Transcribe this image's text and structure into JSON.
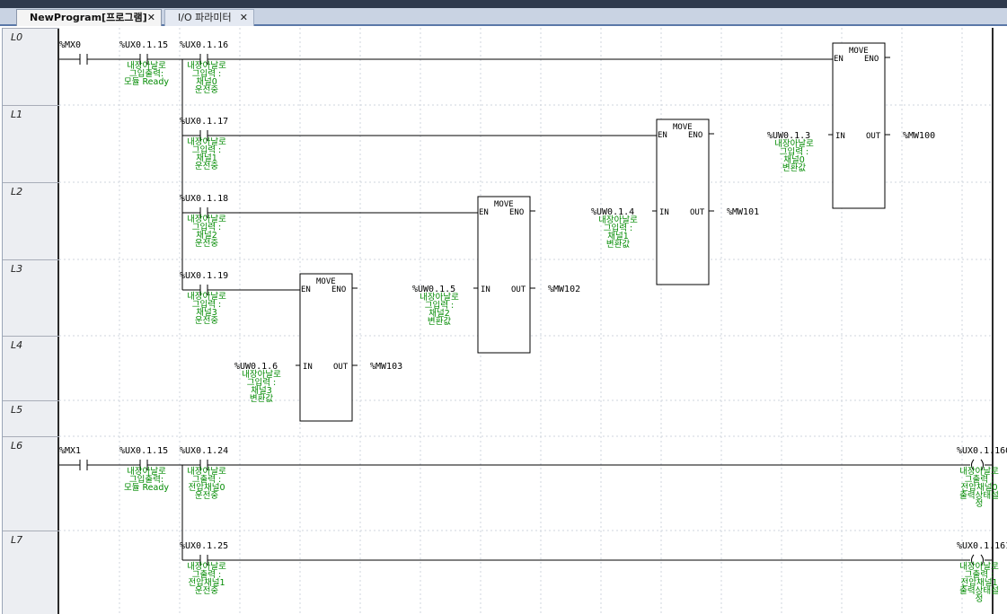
{
  "tabs": [
    {
      "label": "NewProgram[프로그램]",
      "active": true
    },
    {
      "label": "I/O 파라미터",
      "active": false
    }
  ],
  "tab_close_glyph": "✕",
  "rows": [
    "L0",
    "L1",
    "L2",
    "L3",
    "L4",
    "L5",
    "L6",
    "L7"
  ],
  "contacts": [
    {
      "address": "%MX0",
      "comment": []
    },
    {
      "address": "%UX0.1.15",
      "comment": [
        "내장아날로",
        "그입출력:",
        "모듈 Ready"
      ]
    },
    {
      "address": "%UX0.1.16",
      "comment": [
        "내장아날로",
        "그입력 :",
        "채널0",
        "운전중"
      ]
    },
    {
      "address": "%UX0.1.17",
      "comment": [
        "내장아날로",
        "그입력 :",
        "채널1",
        "운전중"
      ]
    },
    {
      "address": "%UX0.1.18",
      "comment": [
        "내장아날로",
        "그입력 :",
        "채널2",
        "운전중"
      ]
    },
    {
      "address": "%UX0.1.19",
      "comment": [
        "내장아날로",
        "그입력 :",
        "채널3",
        "운전중"
      ]
    },
    {
      "address": "%MX1",
      "comment": []
    },
    {
      "address": "%UX0.1.15",
      "comment": [
        "내장아날로",
        "그입출력:",
        "모듈 Ready"
      ]
    },
    {
      "address": "%UX0.1.24",
      "comment": [
        "내장아날로",
        "그출력 :",
        "전압채널0",
        "운전중"
      ]
    },
    {
      "address": "%UX0.1.25",
      "comment": [
        "내장아날로",
        "그출력 :",
        "전압채널1",
        "운전중"
      ]
    }
  ],
  "move_blocks": [
    {
      "name": "MOVE",
      "en": "EN",
      "eno": "ENO",
      "in": "IN",
      "out": "OUT",
      "in_var": "%UW0.1.3",
      "in_comment": [
        "내장아날로",
        "그입력 :",
        "채널0",
        "변환값"
      ],
      "out_var": "%MW100"
    },
    {
      "name": "MOVE",
      "en": "EN",
      "eno": "ENO",
      "in": "IN",
      "out": "OUT",
      "in_var": "%UW0.1.4",
      "in_comment": [
        "내장아날로",
        "그입력 :",
        "채널1",
        "변환값"
      ],
      "out_var": "%MW101"
    },
    {
      "name": "MOVE",
      "en": "EN",
      "eno": "ENO",
      "in": "IN",
      "out": "OUT",
      "in_var": "%UW0.1.5",
      "in_comment": [
        "내장아날로",
        "그입력 :",
        "채널2",
        "변환값"
      ],
      "out_var": "%MW102"
    },
    {
      "name": "MOVE",
      "en": "EN",
      "eno": "ENO",
      "in": "IN",
      "out": "OUT",
      "in_var": "%UW0.1.6",
      "in_comment": [
        "내장아날로",
        "그입력 :",
        "채널3",
        "변환값"
      ],
      "out_var": "%MW103"
    }
  ],
  "coils": [
    {
      "address": "%UX0.1.160",
      "comment": [
        "내장아날로",
        "그출력 :",
        "전압채널0",
        "출력상태설",
        "정"
      ]
    },
    {
      "address": "%UX0.1.161",
      "comment": [
        "내장아날로",
        "그출력 :",
        "전압채널1",
        "출력상태설",
        "정"
      ]
    }
  ],
  "colors": {
    "comment": "#008a00",
    "wire": "#000000",
    "grid": "#cfd4dc",
    "gutter": "#eceef2"
  }
}
